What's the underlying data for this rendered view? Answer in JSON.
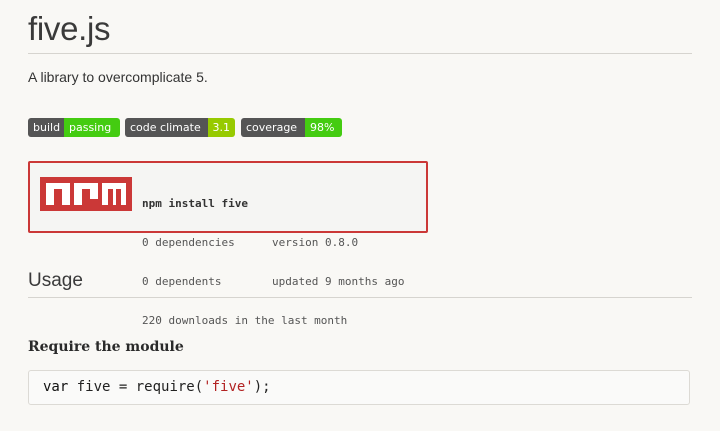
{
  "header": {
    "title": "five.js",
    "description": "A library to overcomplicate 5."
  },
  "badges": [
    {
      "label": "build",
      "value": "passing",
      "color": "#44cc11"
    },
    {
      "label": "code climate",
      "value": "3.1",
      "color": "#97ca00"
    },
    {
      "label": "coverage",
      "value": "98%",
      "color": "#44cc11"
    }
  ],
  "npm": {
    "logo_text": "npm",
    "brand_color": "#cb3837",
    "install_cmd": "npm install five",
    "dependencies": "0 dependencies",
    "version": "version 0.8.0",
    "dependents": "0 dependents",
    "updated": "updated 9 months ago",
    "downloads": "220 downloads in the last month"
  },
  "usage": {
    "section_title": "Usage",
    "subheading": "Require the module",
    "code": {
      "keyword": "var",
      "before_string": " five = require(",
      "string": "'five'",
      "after_string": ");"
    }
  }
}
